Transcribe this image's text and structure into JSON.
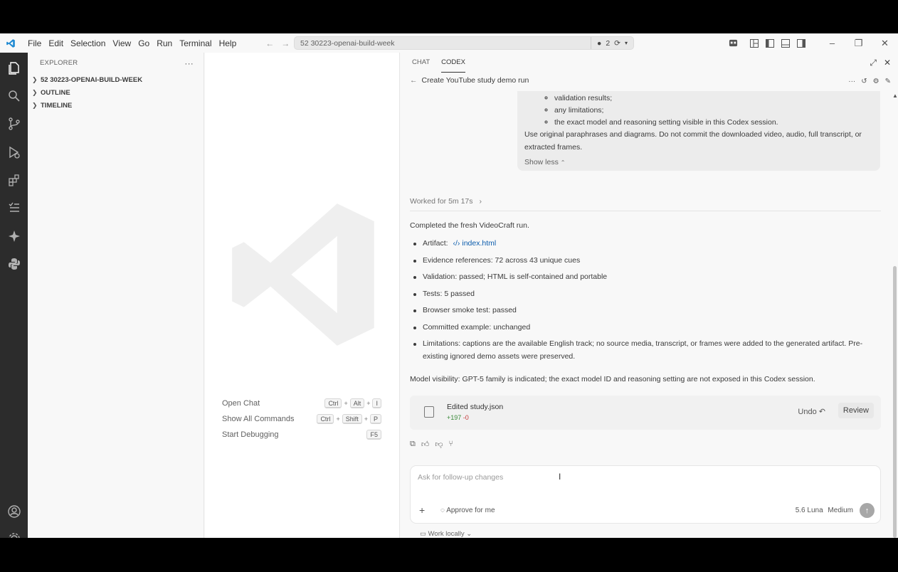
{
  "titlebar": {
    "menu": [
      "File",
      "Edit",
      "Selection",
      "View",
      "Go",
      "Run",
      "Terminal",
      "Help"
    ],
    "search_title": "52 30223-openai-build-week",
    "badge_count": "2",
    "window_controls": [
      "minimize-icon",
      "restore-icon",
      "close-icon"
    ]
  },
  "activitybar": {
    "icons": [
      "explorer-icon",
      "search-icon",
      "source-control-icon",
      "run-debug-icon",
      "extensions-icon",
      "testing-icon",
      "ai-sparkle-icon",
      "python-icon",
      "account-icon",
      "settings-gear-icon"
    ]
  },
  "sidebar": {
    "title": "EXPLORER",
    "sections": [
      "52 30223-OPENAI-BUILD-WEEK",
      "OUTLINE",
      "TIMELINE"
    ]
  },
  "editor": {
    "hints": [
      {
        "label": "Open Chat",
        "keys": [
          "Ctrl",
          "Alt",
          "I"
        ]
      },
      {
        "label": "Show All Commands",
        "keys": [
          "Ctrl",
          "Shift",
          "P"
        ]
      },
      {
        "label": "Start Debugging",
        "keys": [
          "F5"
        ]
      }
    ]
  },
  "panel": {
    "tabs": [
      "CHAT",
      "CODEX"
    ],
    "active_tab": "CODEX",
    "thread_title": "Create YouTube study demo run",
    "user_message": {
      "bullets": [
        "validation results;",
        "any limitations;",
        "the exact model and reasoning setting visible in this Codex session."
      ],
      "paragraph": "Use original paraphrases and diagrams. Do not commit the downloaded video, audio, full transcript, or extracted frames.",
      "show_less": "Show less"
    },
    "worked_for": "Worked for 5m 17s",
    "completed": "Completed the fresh VideoCraft run.",
    "artifact_label": "Artifact:",
    "artifact_link": "index.html",
    "results": [
      "Evidence references: 72 across 43 unique cues",
      "Validation: passed; HTML is self-contained and portable",
      "Tests: 5 passed",
      "Browser smoke test: passed",
      "Committed example: unchanged",
      "Limitations: captions are the available English track; no source media, transcript, or frames were added to the generated artifact. Pre-existing ignored demo assets were preserved."
    ],
    "model_visibility": "Model visibility: GPT-5 family is indicated; the exact model ID and reasoning setting are not exposed in this Codex session.",
    "edit_card": {
      "filename": "Edited study.json",
      "additions": "+197",
      "deletions": "-0",
      "undo": "Undo",
      "review": "Review"
    },
    "composer": {
      "placeholder": "Ask for follow-up changes",
      "approve": "Approve for me",
      "model": "5.6 Luna",
      "effort": "Medium",
      "work_locally": "Work locally"
    }
  }
}
